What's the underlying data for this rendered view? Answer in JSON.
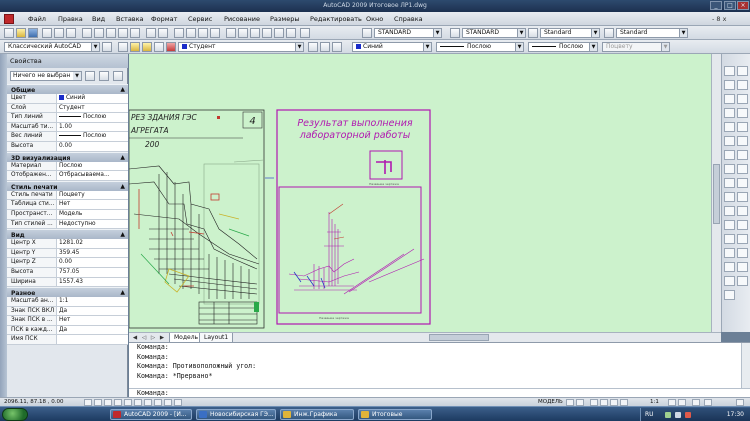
{
  "window": {
    "title": "AutoCAD 2009 Итоговое ЛР1.dwg",
    "controls": [
      "minimize",
      "maximize",
      "close"
    ]
  },
  "menu": {
    "items": [
      "Файл",
      "Правка",
      "Вид",
      "Вставка",
      "Формат",
      "Сервис",
      "Рисование",
      "Размеры",
      "Редактировать",
      "Окно",
      "Справка"
    ],
    "right_controls": "- 8 x"
  },
  "toolbar": {
    "text_style": "STANDARD",
    "dim_style": "STANDARD",
    "table_style": "Standard",
    "mleader_style": "Standard",
    "workspace": "Классический AutoCAD",
    "layer": "Студент",
    "color": "Синий",
    "linetype": "Послою",
    "lineweight": "Послою",
    "plotstyle": "Поцвету"
  },
  "properties": {
    "palette_title": "Свойства",
    "selection": "Ничего не выбран",
    "sections": [
      {
        "name": "Общие",
        "rows": [
          {
            "key": "Цвет",
            "value": "Синий",
            "swatch": "#1a2cc9"
          },
          {
            "key": "Слой",
            "value": "Студент"
          },
          {
            "key": "Тип линий",
            "value": "Послою",
            "line": true
          },
          {
            "key": "Масштаб ти...",
            "value": "1.00"
          },
          {
            "key": "Вес линий",
            "value": "Послою",
            "line": true
          },
          {
            "key": "Высота",
            "value": "0.00"
          }
        ]
      },
      {
        "name": "3D визуализация",
        "rows": [
          {
            "key": "Материал",
            "value": "Послою"
          },
          {
            "key": "Отображен...",
            "value": "Отбрасываема..."
          }
        ]
      },
      {
        "name": "Стиль печати",
        "rows": [
          {
            "key": "Стиль печати",
            "value": "Поцвету"
          },
          {
            "key": "Таблица сти...",
            "value": "Нет"
          },
          {
            "key": "Пространст...",
            "value": "Модель"
          },
          {
            "key": "Тип стилей ...",
            "value": "Недоступно"
          }
        ]
      },
      {
        "name": "Вид",
        "rows": [
          {
            "key": "Центр X",
            "value": "1281.02"
          },
          {
            "key": "Центр Y",
            "value": "359.45"
          },
          {
            "key": "Центр Z",
            "value": "0.00"
          },
          {
            "key": "Высота",
            "value": "757.05"
          },
          {
            "key": "Ширина",
            "value": "1557.43"
          }
        ]
      },
      {
        "name": "Разное",
        "rows": [
          {
            "key": "Масштаб ан...",
            "value": "1:1"
          },
          {
            "key": "Знак ПСК ВКЛ",
            "value": "Да"
          },
          {
            "key": "Знак ПСК в ...",
            "value": "Нет"
          },
          {
            "key": "ПСК в кажд...",
            "value": "Да"
          },
          {
            "key": "Имя ПСК",
            "value": ""
          }
        ]
      }
    ]
  },
  "drawing": {
    "left_sheet_number": "4",
    "left_title_1": "РЕЗ ЗДАНИЯ ГЭС",
    "left_title_2": "АГРЕГАТА",
    "left_title_3": "200",
    "result_title_1": "Результат выполнения",
    "result_title_2": "лабораторной работы",
    "small_caption_1": "Название чертежа",
    "small_caption_2": "Название чертежа"
  },
  "layout_tabs": [
    "Модель",
    "Layout1"
  ],
  "command": {
    "lines": [
      "Команда:",
      "Команда:",
      "Команда: Противоположный угол:",
      "Команда: *Прервано*"
    ],
    "prompt": "Команда:"
  },
  "status": {
    "coords": "2096.11, 87.18 , 0.00",
    "model_label": "МОДЕЛЬ",
    "scale": "1:1"
  },
  "taskbar": {
    "tasks": [
      {
        "label": "AutoCAD 2009 - [И...",
        "color": "#c0282b"
      },
      {
        "label": "Новосибирская ГЭ...",
        "color": "#3a6fc4"
      },
      {
        "label": "Инж.Графика",
        "color": "#e0b43a"
      },
      {
        "label": "Итоговые",
        "color": "#e0b43a"
      }
    ],
    "language": "RU",
    "clock": "17:30"
  }
}
